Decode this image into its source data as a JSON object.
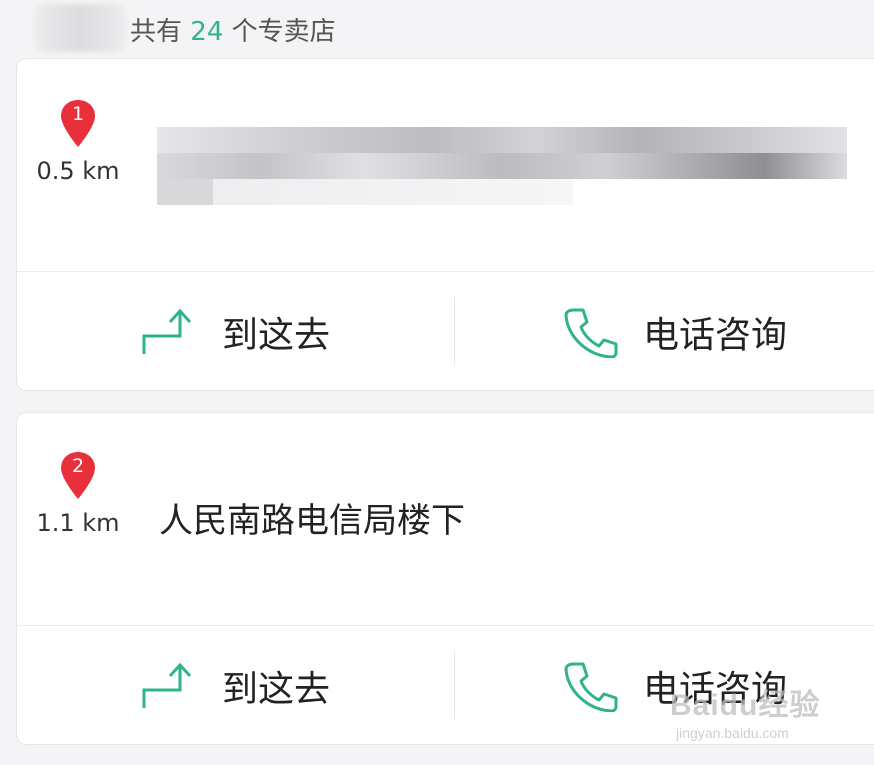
{
  "header": {
    "prefix": "共有",
    "count": "24",
    "suffix": "个专卖店"
  },
  "stores": [
    {
      "rank": "1",
      "distance": "0.5 km",
      "address": "",
      "address_obscured": true
    },
    {
      "rank": "2",
      "distance": "1.1 km",
      "address": "人民南路电信局楼下",
      "address_obscured": false
    }
  ],
  "actions": {
    "navigate_label": "到这去",
    "call_label": "电话咨询"
  },
  "icons": {
    "pin": "map-pin-icon",
    "navigate": "turn-arrow-icon",
    "call": "phone-icon"
  },
  "colors": {
    "accent": "#2fb38f",
    "pin": "#e8303a"
  },
  "watermark": {
    "brand": "Baidu经验",
    "url": "jingyan.baidu.com"
  }
}
